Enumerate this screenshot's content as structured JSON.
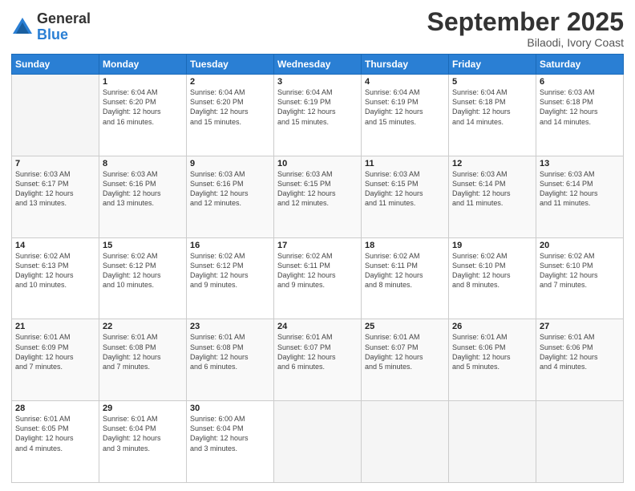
{
  "logo": {
    "general": "General",
    "blue": "Blue"
  },
  "header": {
    "month": "September 2025",
    "location": "Bilaodi, Ivory Coast"
  },
  "days_of_week": [
    "Sunday",
    "Monday",
    "Tuesday",
    "Wednesday",
    "Thursday",
    "Friday",
    "Saturday"
  ],
  "weeks": [
    [
      {
        "day": "",
        "info": ""
      },
      {
        "day": "1",
        "info": "Sunrise: 6:04 AM\nSunset: 6:20 PM\nDaylight: 12 hours\nand 16 minutes."
      },
      {
        "day": "2",
        "info": "Sunrise: 6:04 AM\nSunset: 6:20 PM\nDaylight: 12 hours\nand 15 minutes."
      },
      {
        "day": "3",
        "info": "Sunrise: 6:04 AM\nSunset: 6:19 PM\nDaylight: 12 hours\nand 15 minutes."
      },
      {
        "day": "4",
        "info": "Sunrise: 6:04 AM\nSunset: 6:19 PM\nDaylight: 12 hours\nand 15 minutes."
      },
      {
        "day": "5",
        "info": "Sunrise: 6:04 AM\nSunset: 6:18 PM\nDaylight: 12 hours\nand 14 minutes."
      },
      {
        "day": "6",
        "info": "Sunrise: 6:03 AM\nSunset: 6:18 PM\nDaylight: 12 hours\nand 14 minutes."
      }
    ],
    [
      {
        "day": "7",
        "info": "Sunrise: 6:03 AM\nSunset: 6:17 PM\nDaylight: 12 hours\nand 13 minutes."
      },
      {
        "day": "8",
        "info": "Sunrise: 6:03 AM\nSunset: 6:16 PM\nDaylight: 12 hours\nand 13 minutes."
      },
      {
        "day": "9",
        "info": "Sunrise: 6:03 AM\nSunset: 6:16 PM\nDaylight: 12 hours\nand 12 minutes."
      },
      {
        "day": "10",
        "info": "Sunrise: 6:03 AM\nSunset: 6:15 PM\nDaylight: 12 hours\nand 12 minutes."
      },
      {
        "day": "11",
        "info": "Sunrise: 6:03 AM\nSunset: 6:15 PM\nDaylight: 12 hours\nand 11 minutes."
      },
      {
        "day": "12",
        "info": "Sunrise: 6:03 AM\nSunset: 6:14 PM\nDaylight: 12 hours\nand 11 minutes."
      },
      {
        "day": "13",
        "info": "Sunrise: 6:03 AM\nSunset: 6:14 PM\nDaylight: 12 hours\nand 11 minutes."
      }
    ],
    [
      {
        "day": "14",
        "info": "Sunrise: 6:02 AM\nSunset: 6:13 PM\nDaylight: 12 hours\nand 10 minutes."
      },
      {
        "day": "15",
        "info": "Sunrise: 6:02 AM\nSunset: 6:12 PM\nDaylight: 12 hours\nand 10 minutes."
      },
      {
        "day": "16",
        "info": "Sunrise: 6:02 AM\nSunset: 6:12 PM\nDaylight: 12 hours\nand 9 minutes."
      },
      {
        "day": "17",
        "info": "Sunrise: 6:02 AM\nSunset: 6:11 PM\nDaylight: 12 hours\nand 9 minutes."
      },
      {
        "day": "18",
        "info": "Sunrise: 6:02 AM\nSunset: 6:11 PM\nDaylight: 12 hours\nand 8 minutes."
      },
      {
        "day": "19",
        "info": "Sunrise: 6:02 AM\nSunset: 6:10 PM\nDaylight: 12 hours\nand 8 minutes."
      },
      {
        "day": "20",
        "info": "Sunrise: 6:02 AM\nSunset: 6:10 PM\nDaylight: 12 hours\nand 7 minutes."
      }
    ],
    [
      {
        "day": "21",
        "info": "Sunrise: 6:01 AM\nSunset: 6:09 PM\nDaylight: 12 hours\nand 7 minutes."
      },
      {
        "day": "22",
        "info": "Sunrise: 6:01 AM\nSunset: 6:08 PM\nDaylight: 12 hours\nand 7 minutes."
      },
      {
        "day": "23",
        "info": "Sunrise: 6:01 AM\nSunset: 6:08 PM\nDaylight: 12 hours\nand 6 minutes."
      },
      {
        "day": "24",
        "info": "Sunrise: 6:01 AM\nSunset: 6:07 PM\nDaylight: 12 hours\nand 6 minutes."
      },
      {
        "day": "25",
        "info": "Sunrise: 6:01 AM\nSunset: 6:07 PM\nDaylight: 12 hours\nand 5 minutes."
      },
      {
        "day": "26",
        "info": "Sunrise: 6:01 AM\nSunset: 6:06 PM\nDaylight: 12 hours\nand 5 minutes."
      },
      {
        "day": "27",
        "info": "Sunrise: 6:01 AM\nSunset: 6:06 PM\nDaylight: 12 hours\nand 4 minutes."
      }
    ],
    [
      {
        "day": "28",
        "info": "Sunrise: 6:01 AM\nSunset: 6:05 PM\nDaylight: 12 hours\nand 4 minutes."
      },
      {
        "day": "29",
        "info": "Sunrise: 6:01 AM\nSunset: 6:04 PM\nDaylight: 12 hours\nand 3 minutes."
      },
      {
        "day": "30",
        "info": "Sunrise: 6:00 AM\nSunset: 6:04 PM\nDaylight: 12 hours\nand 3 minutes."
      },
      {
        "day": "",
        "info": ""
      },
      {
        "day": "",
        "info": ""
      },
      {
        "day": "",
        "info": ""
      },
      {
        "day": "",
        "info": ""
      }
    ]
  ]
}
